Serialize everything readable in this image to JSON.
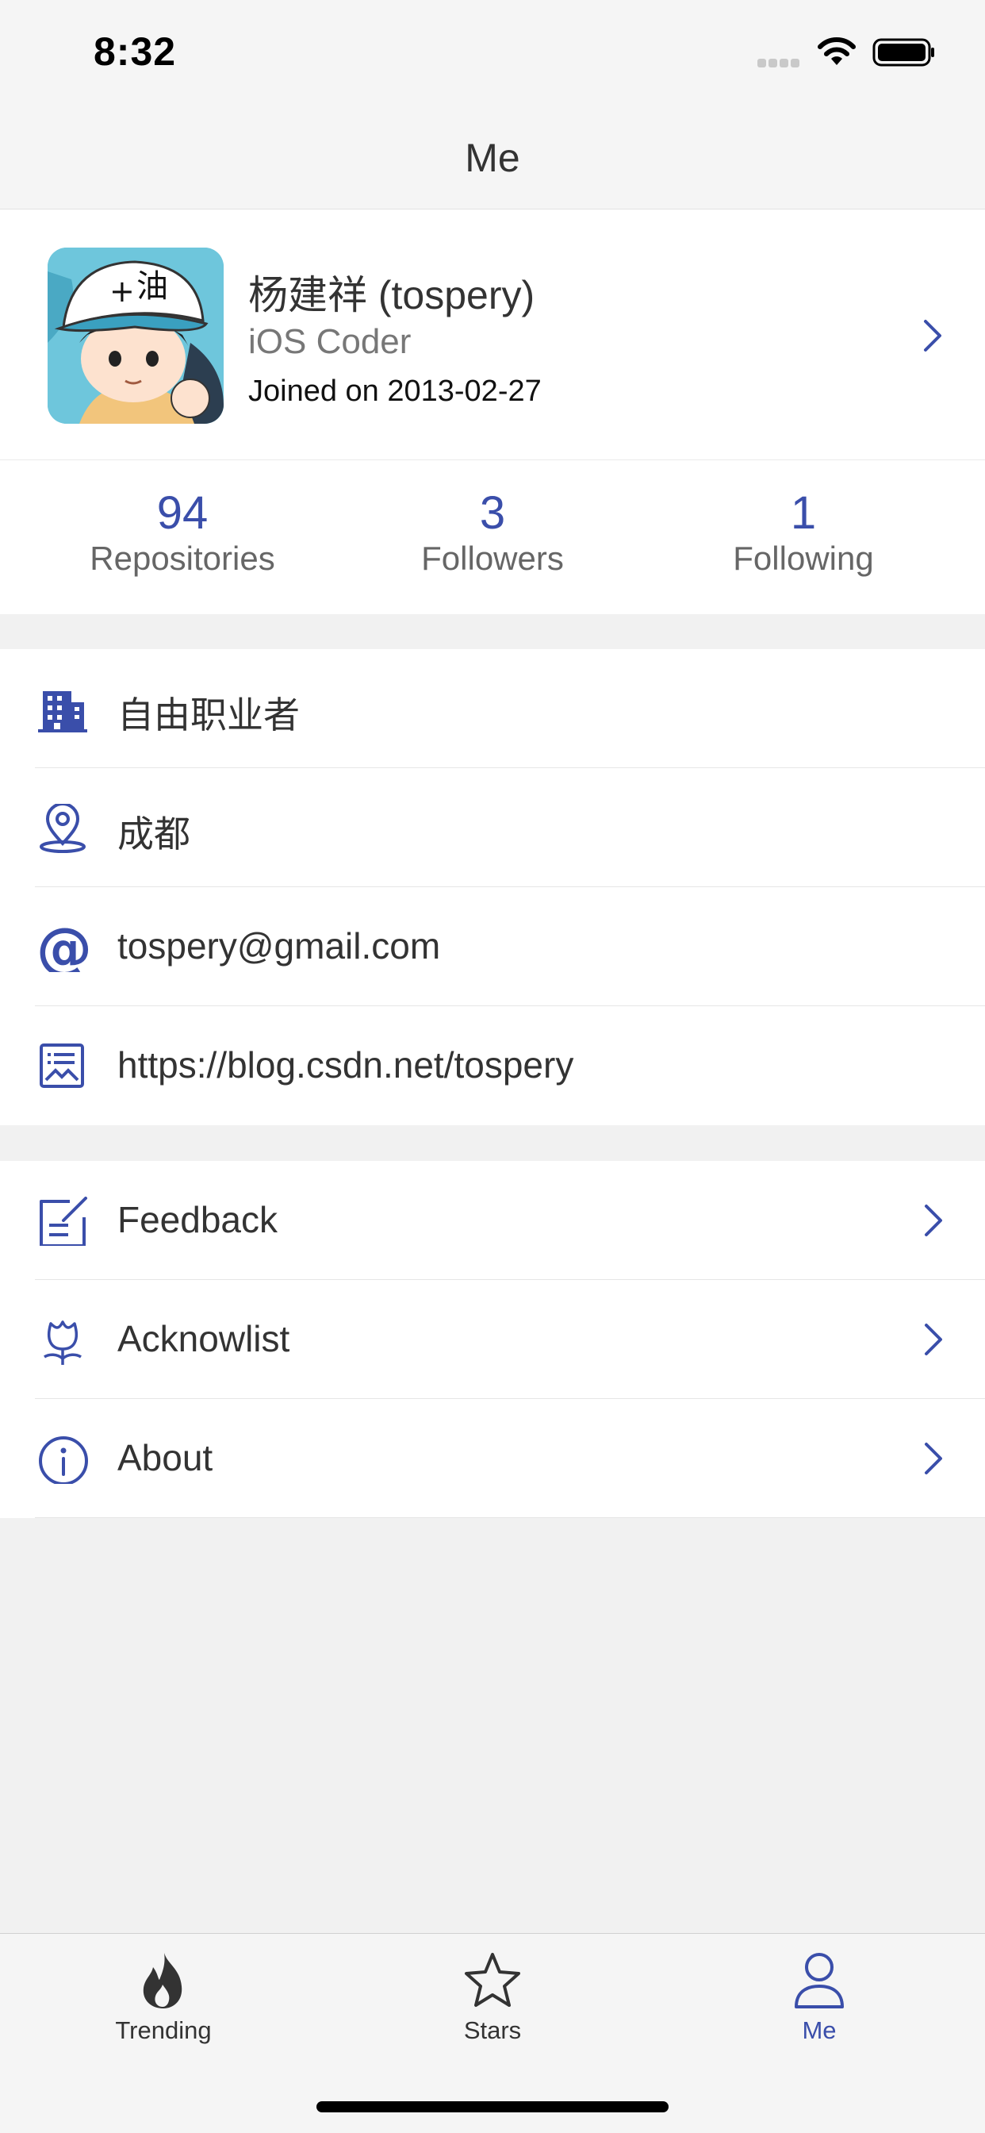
{
  "status_bar": {
    "time": "8:32",
    "icons": [
      "signal-icon",
      "wifi-icon",
      "battery-icon"
    ]
  },
  "nav": {
    "title": "Me"
  },
  "profile": {
    "name": "杨建祥 (tospery)",
    "bio": "iOS Coder",
    "joined": "Joined on 2013-02-27",
    "avatar_icon": "avatar-cartoon"
  },
  "stats": [
    {
      "value": "94",
      "label": "Repositories"
    },
    {
      "value": "3",
      "label": "Followers"
    },
    {
      "value": "1",
      "label": "Following"
    }
  ],
  "info_section": [
    {
      "icon": "building-icon",
      "label": "自由职业者"
    },
    {
      "icon": "location-icon",
      "label": "成都"
    },
    {
      "icon": "at-icon",
      "label": "tospery@gmail.com"
    },
    {
      "icon": "blog-icon",
      "label": "https://blog.csdn.net/tospery"
    }
  ],
  "menu_section": [
    {
      "icon": "feedback-icon",
      "label": "Feedback"
    },
    {
      "icon": "flower-icon",
      "label": "Acknowlist"
    },
    {
      "icon": "info-icon",
      "label": "About"
    }
  ],
  "tab_bar": [
    {
      "icon": "flame-icon",
      "label": "Trending",
      "active": false
    },
    {
      "icon": "star-icon",
      "label": "Stars",
      "active": false
    },
    {
      "icon": "person-icon",
      "label": "Me",
      "active": true
    }
  ],
  "colors": {
    "accent": "#3a4eaa",
    "background": "#f1f1f1",
    "text": "#333333"
  }
}
